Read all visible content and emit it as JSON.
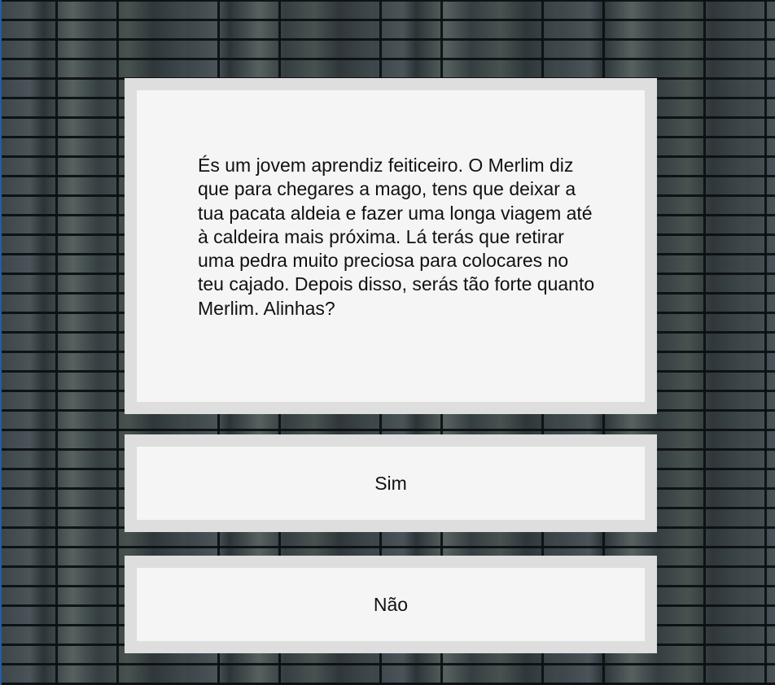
{
  "story": {
    "text": "És um jovem aprendiz feiticeiro. O Merlim diz que para chegares a mago, tens que deixar a tua pacata aldeia e fazer uma longa viagem até à caldeira mais próxima. Lá terás que retirar uma pedra muito preciosa para colocares no teu cajado. Depois disso, serás tão forte quanto Merlim. Alinhas?"
  },
  "choices": [
    {
      "label": "Sim"
    },
    {
      "label": "Não"
    }
  ],
  "colors": {
    "panel_background": "#f5f5f5",
    "panel_border": "#dedede",
    "text": "#111111"
  }
}
